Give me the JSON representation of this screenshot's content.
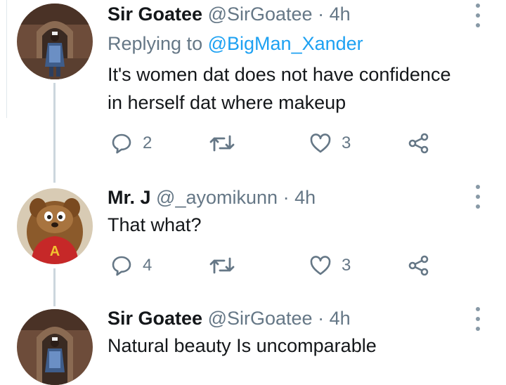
{
  "colors": {
    "link": "#1da1f2",
    "secondary": "#657786",
    "text": "#14171a",
    "thread_line": "#ccd6dd"
  },
  "tweets": [
    {
      "name": "Sir Goatee",
      "handle": "@SirGoatee",
      "separator": "·",
      "time": "4h",
      "reply_prefix": "Replying to",
      "reply_to": "@BigMan_Xander",
      "text_lines": [
        "It's women dat does not have confidence",
        "in herself dat where makeup"
      ],
      "replies": "2",
      "likes": "3",
      "icons": [
        "reply-icon",
        "retweet-icon",
        "heart-icon",
        "share-icon",
        "more-icon"
      ]
    },
    {
      "name": "Mr. J",
      "handle": "@_ayomikunn",
      "separator": "·",
      "time": "4h",
      "text_lines": [
        "That what?"
      ],
      "replies": "4",
      "likes": "3",
      "avatar_letter": "A",
      "icons": [
        "reply-icon",
        "retweet-icon",
        "heart-icon",
        "share-icon",
        "more-icon"
      ]
    },
    {
      "name": "Sir Goatee",
      "handle": "@SirGoatee",
      "separator": "·",
      "time": "4h",
      "text_lines": [
        "Natural beauty Is uncomparable"
      ]
    }
  ]
}
